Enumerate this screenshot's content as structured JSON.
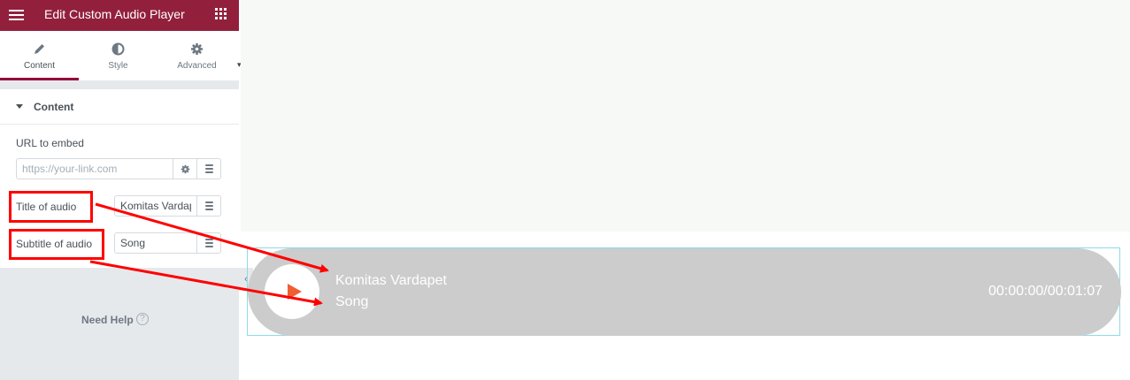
{
  "header": {
    "title": "Edit Custom Audio Player",
    "accent_color": "#92203c",
    "menu_icon": "hamburger-icon",
    "widgets_icon": "grid-icon"
  },
  "tabs": [
    {
      "label": "Content",
      "icon": "pencil-icon",
      "active": true
    },
    {
      "label": "Style",
      "icon": "half-circle-icon",
      "active": false
    },
    {
      "label": "Advanced",
      "icon": "gear-icon",
      "active": false
    }
  ],
  "section": {
    "title": "Content",
    "url": {
      "label": "URL to embed",
      "value": "",
      "placeholder": "https://your-link.com"
    },
    "title_field": {
      "label": "Title of audio",
      "value": "Komitas Vardapet"
    },
    "subtitle_field": {
      "label": "Subtitle of audio",
      "value": "Song"
    }
  },
  "help": {
    "label": "Need Help",
    "icon": "?"
  },
  "collapse_icon": "‹",
  "player": {
    "title": "Komitas Vardapet",
    "subtitle": "Song",
    "time": "00:00:00/00:01:07",
    "background_color": "#cccccc",
    "play_color": "#ef5f33"
  },
  "annotations": {
    "color": "#ff0000"
  }
}
